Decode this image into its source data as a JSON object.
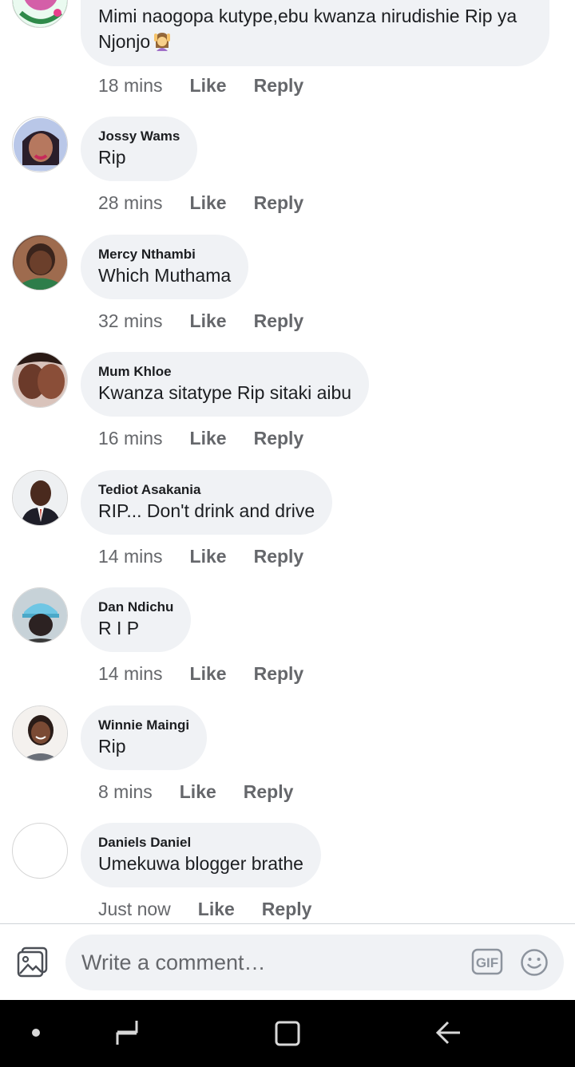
{
  "comments": [
    {
      "author": "",
      "text": "Mimi naogopa kutype,ebu kwanza nirudishie Rip ya Njonjo",
      "emoji": "woman-raising-hand-emoji",
      "time": "18 mins",
      "like": "Like",
      "reply": "Reply"
    },
    {
      "author": "Jossy Wams",
      "text": "Rip",
      "time": "28 mins",
      "like": "Like",
      "reply": "Reply"
    },
    {
      "author": "Mercy Nthambi",
      "text": "Which Muthama",
      "time": "32 mins",
      "like": "Like",
      "reply": "Reply"
    },
    {
      "author": "Mum Khloe",
      "text": "Kwanza sitatype Rip sitaki aibu",
      "time": "16 mins",
      "like": "Like",
      "reply": "Reply"
    },
    {
      "author": "Tediot Asakania",
      "text": "RIP... Don't drink and drive",
      "time": "14 mins",
      "like": "Like",
      "reply": "Reply"
    },
    {
      "author": "Dan Ndichu",
      "text": "R I P",
      "time": "14 mins",
      "like": "Like",
      "reply": "Reply"
    },
    {
      "author": "Winnie Maingi",
      "text": "Rip",
      "time": "8 mins",
      "like": "Like",
      "reply": "Reply"
    },
    {
      "author": "Daniels Daniel",
      "text": "Umekuwa blogger brathe",
      "time": "Just now",
      "like": "Like",
      "reply": "Reply"
    }
  ],
  "composer": {
    "placeholder": "Write a comment…",
    "photo_icon": "photo-icon",
    "gif_label": "GIF",
    "emoji_icon": "smiley-icon"
  },
  "navbar": {
    "icons": [
      "dot-icon",
      "recent-apps-icon",
      "home-icon",
      "back-icon"
    ]
  },
  "colors": {
    "bubble": "#f0f2f5",
    "meta_text": "#65676b",
    "primary_text": "#1c1e21",
    "navbar": "#000000"
  }
}
